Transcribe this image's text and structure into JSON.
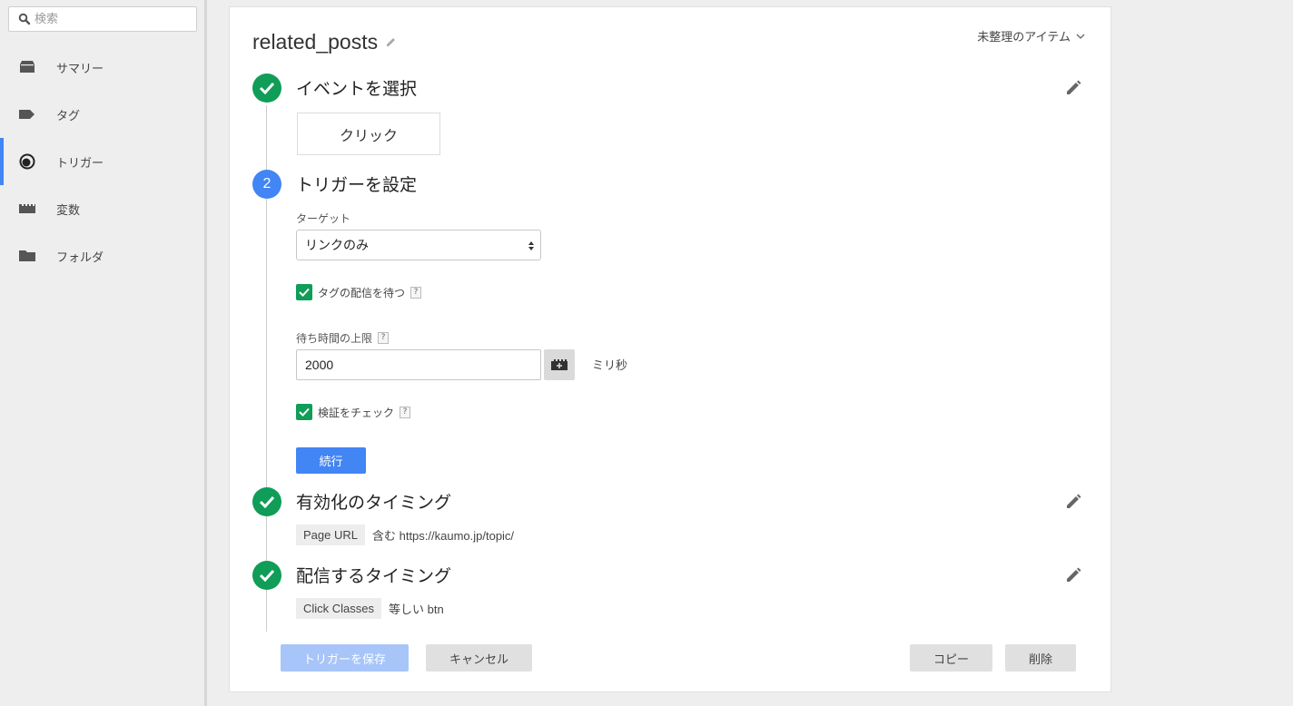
{
  "sidebar": {
    "search_placeholder": "検索",
    "items": [
      {
        "label": "サマリー",
        "icon": "inbox-icon"
      },
      {
        "label": "タグ",
        "icon": "tag-icon"
      },
      {
        "label": "トリガー",
        "icon": "trigger-icon",
        "active": true
      },
      {
        "label": "変数",
        "icon": "variables-icon"
      },
      {
        "label": "フォルダ",
        "icon": "folder-icon"
      }
    ]
  },
  "header": {
    "title": "related_posts",
    "folder_label": "未整理のアイテム"
  },
  "steps": {
    "event": {
      "title": "イベントを選択",
      "value": "クリック"
    },
    "configure": {
      "number": "2",
      "title": "トリガーを設定",
      "target_label": "ターゲット",
      "target_value": "リンクのみ",
      "wait_tags_label": "タグの配信を待つ",
      "wait_limit_label": "待ち時間の上限",
      "wait_limit_value": "2000",
      "unit": "ミリ秒",
      "check_validation_label": "検証をチェック",
      "help": "?",
      "continue_label": "続行"
    },
    "enable": {
      "title": "有効化のタイミング",
      "variable": "Page URL",
      "condition": "含む https://kaumo.jp/topic/"
    },
    "fire": {
      "title": "配信するタイミング",
      "variable": "Click Classes",
      "condition": "等しい btn"
    }
  },
  "footer": {
    "save_label": "トリガーを保存",
    "cancel_label": "キャンセル",
    "copy_label": "コピー",
    "delete_label": "削除"
  },
  "colors": {
    "accent": "#4285f4",
    "success": "#0f9d58",
    "save_disabled": "#a7c5f9"
  }
}
